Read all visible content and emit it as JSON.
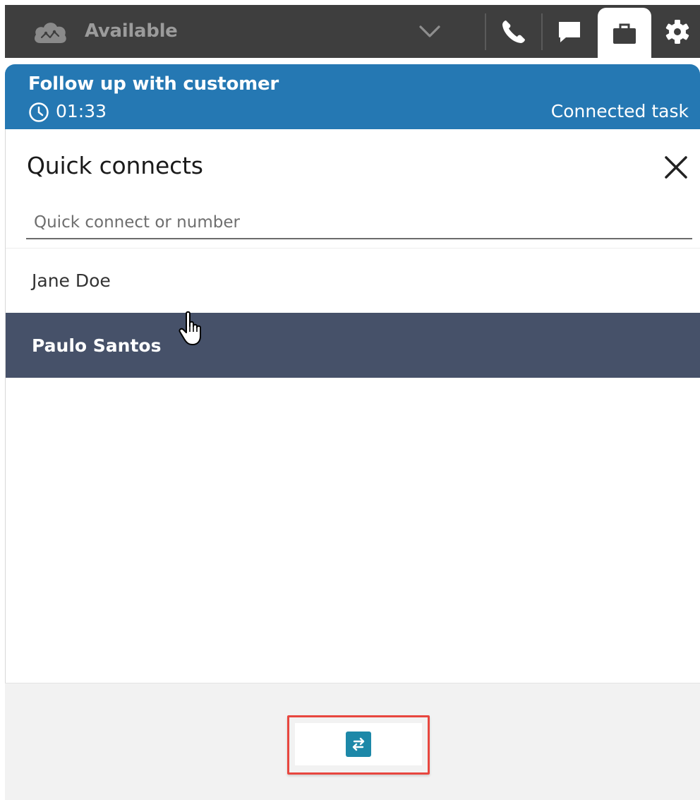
{
  "topbar": {
    "status_label": "Available",
    "icons": [
      "cloud-status-icon",
      "chevron-down-icon",
      "phone-icon",
      "chat-icon",
      "briefcase-icon",
      "gear-icon"
    ],
    "active_tab": "briefcase"
  },
  "banner": {
    "title": "Follow up with customer",
    "timer": "01:33",
    "state": "Connected task",
    "color": "#2578b3"
  },
  "panel": {
    "title": "Quick connects",
    "search_placeholder": "Quick connect or number",
    "items": [
      {
        "label": "Jane Doe",
        "selected": false
      },
      {
        "label": "Paulo Santos",
        "selected": true
      }
    ],
    "selected_color": "#465169"
  },
  "footer": {
    "transfer_icon": "transfer-arrows-icon",
    "highlight_color": "#e8473f"
  }
}
